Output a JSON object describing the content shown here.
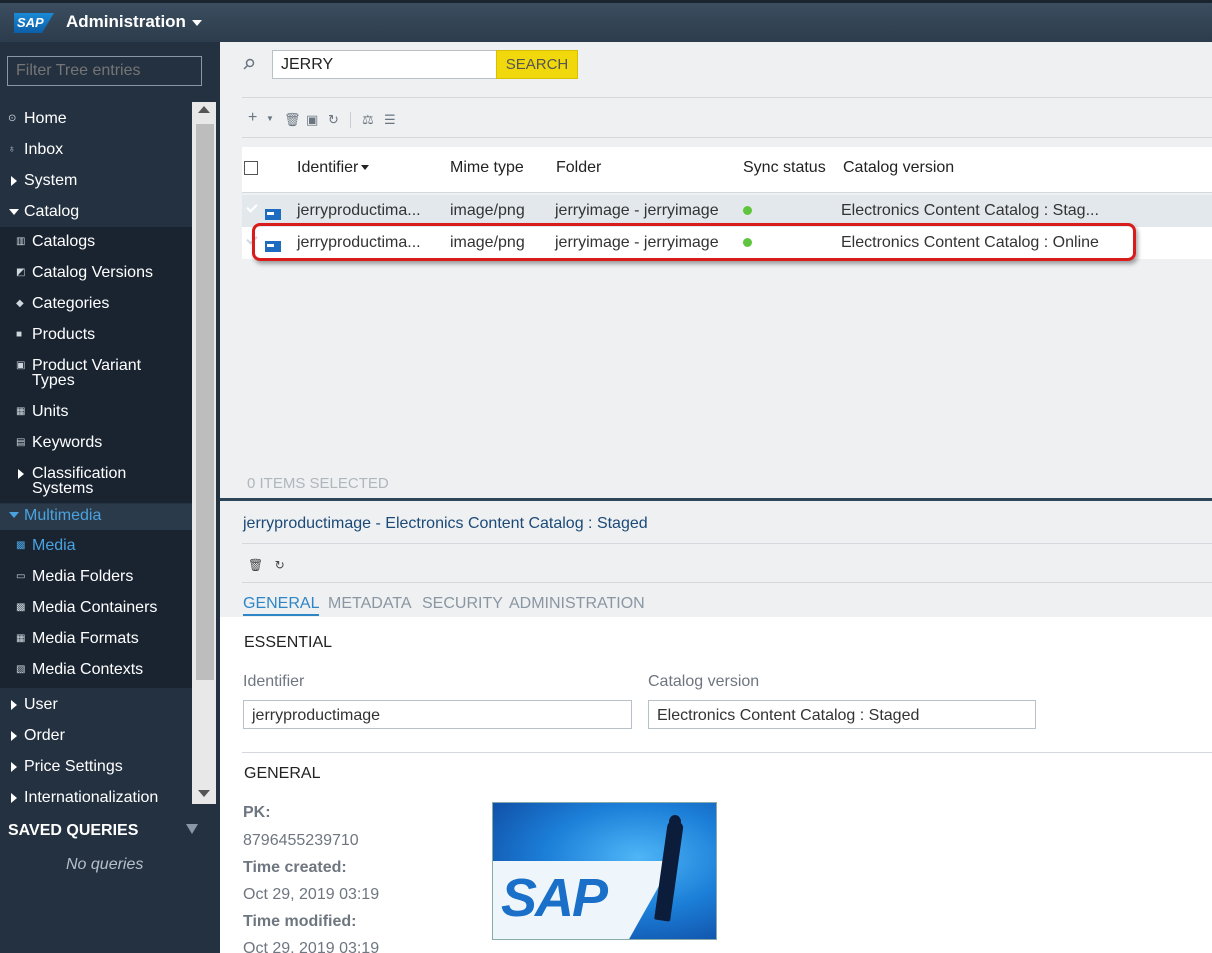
{
  "header": {
    "logo_text": "SAP",
    "title": "Administration"
  },
  "sidebar": {
    "filter_placeholder": "Filter Tree entries",
    "items": [
      {
        "label": "Home",
        "icon": "home-icon"
      },
      {
        "label": "Inbox",
        "icon": "inbox-icon"
      },
      {
        "label": "System",
        "icon": "expand-arrow-icon"
      },
      {
        "label": "Catalog",
        "icon": "collapse-arrow-icon"
      },
      {
        "label": "Catalogs",
        "icon": "catalogs-icon"
      },
      {
        "label": "Catalog Versions",
        "icon": "catalog-versions-icon"
      },
      {
        "label": "Categories",
        "icon": "categories-icon"
      },
      {
        "label": "Products",
        "icon": "products-icon"
      },
      {
        "label": "Product Variant Types",
        "icon": "variant-types-icon"
      },
      {
        "label": "Units",
        "icon": "units-icon"
      },
      {
        "label": "Keywords",
        "icon": "keywords-icon"
      },
      {
        "label": "Classification Systems",
        "icon": "expand-arrow-icon"
      },
      {
        "label": "Multimedia",
        "icon": "collapse-arrow-icon"
      },
      {
        "label": "Media",
        "icon": "media-icon"
      },
      {
        "label": "Media Folders",
        "icon": "media-folders-icon"
      },
      {
        "label": "Media Containers",
        "icon": "media-containers-icon"
      },
      {
        "label": "Media Formats",
        "icon": "media-formats-icon"
      },
      {
        "label": "Media Contexts",
        "icon": "media-contexts-icon"
      },
      {
        "label": "User",
        "icon": "expand-arrow-icon"
      },
      {
        "label": "Order",
        "icon": "expand-arrow-icon"
      },
      {
        "label": "Price Settings",
        "icon": "expand-arrow-icon"
      },
      {
        "label": "Internationalization",
        "icon": "expand-arrow-icon"
      }
    ],
    "saved_queries_title": "SAVED QUERIES",
    "no_queries": "No queries"
  },
  "search": {
    "value": "JERRY",
    "button_label": "SEARCH"
  },
  "grid": {
    "columns": [
      "Identifier",
      "Mime type",
      "Folder",
      "Sync status",
      "Catalog version"
    ],
    "rows": [
      {
        "identifier": "jerryproductima...",
        "mime": "image/png",
        "folder": "jerryimage - jerryimage",
        "catalog": "Electronics Content Catalog : Stag..."
      },
      {
        "identifier": "jerryproductima...",
        "mime": "image/png",
        "folder": "jerryimage - jerryimage",
        "catalog": "Electronics Content Catalog : Online"
      }
    ],
    "items_selected": "0 ITEMS SELECTED",
    "sync_color": "#5fc53f",
    "highlight_color": "#d81b1b"
  },
  "editor": {
    "title": "jerryproductimage - Electronics Content Catalog : Staged",
    "tabs": [
      "GENERAL",
      "METADATA",
      "SECURITY",
      "ADMINISTRATION"
    ],
    "essential_title": "ESSENTIAL",
    "identifier_label": "Identifier",
    "identifier_value": "jerryproductimage",
    "catalog_label": "Catalog version",
    "catalog_value": "Electronics Content Catalog : Staged",
    "general_title": "GENERAL",
    "pk_label": "PK:",
    "pk_value": "8796455239710",
    "created_label": "Time created:",
    "created_value": "Oct 29, 2019 03:19",
    "modified_label": "Time modified:",
    "modified_value": "Oct 29, 2019 03:19",
    "preview_text": "SAP"
  }
}
